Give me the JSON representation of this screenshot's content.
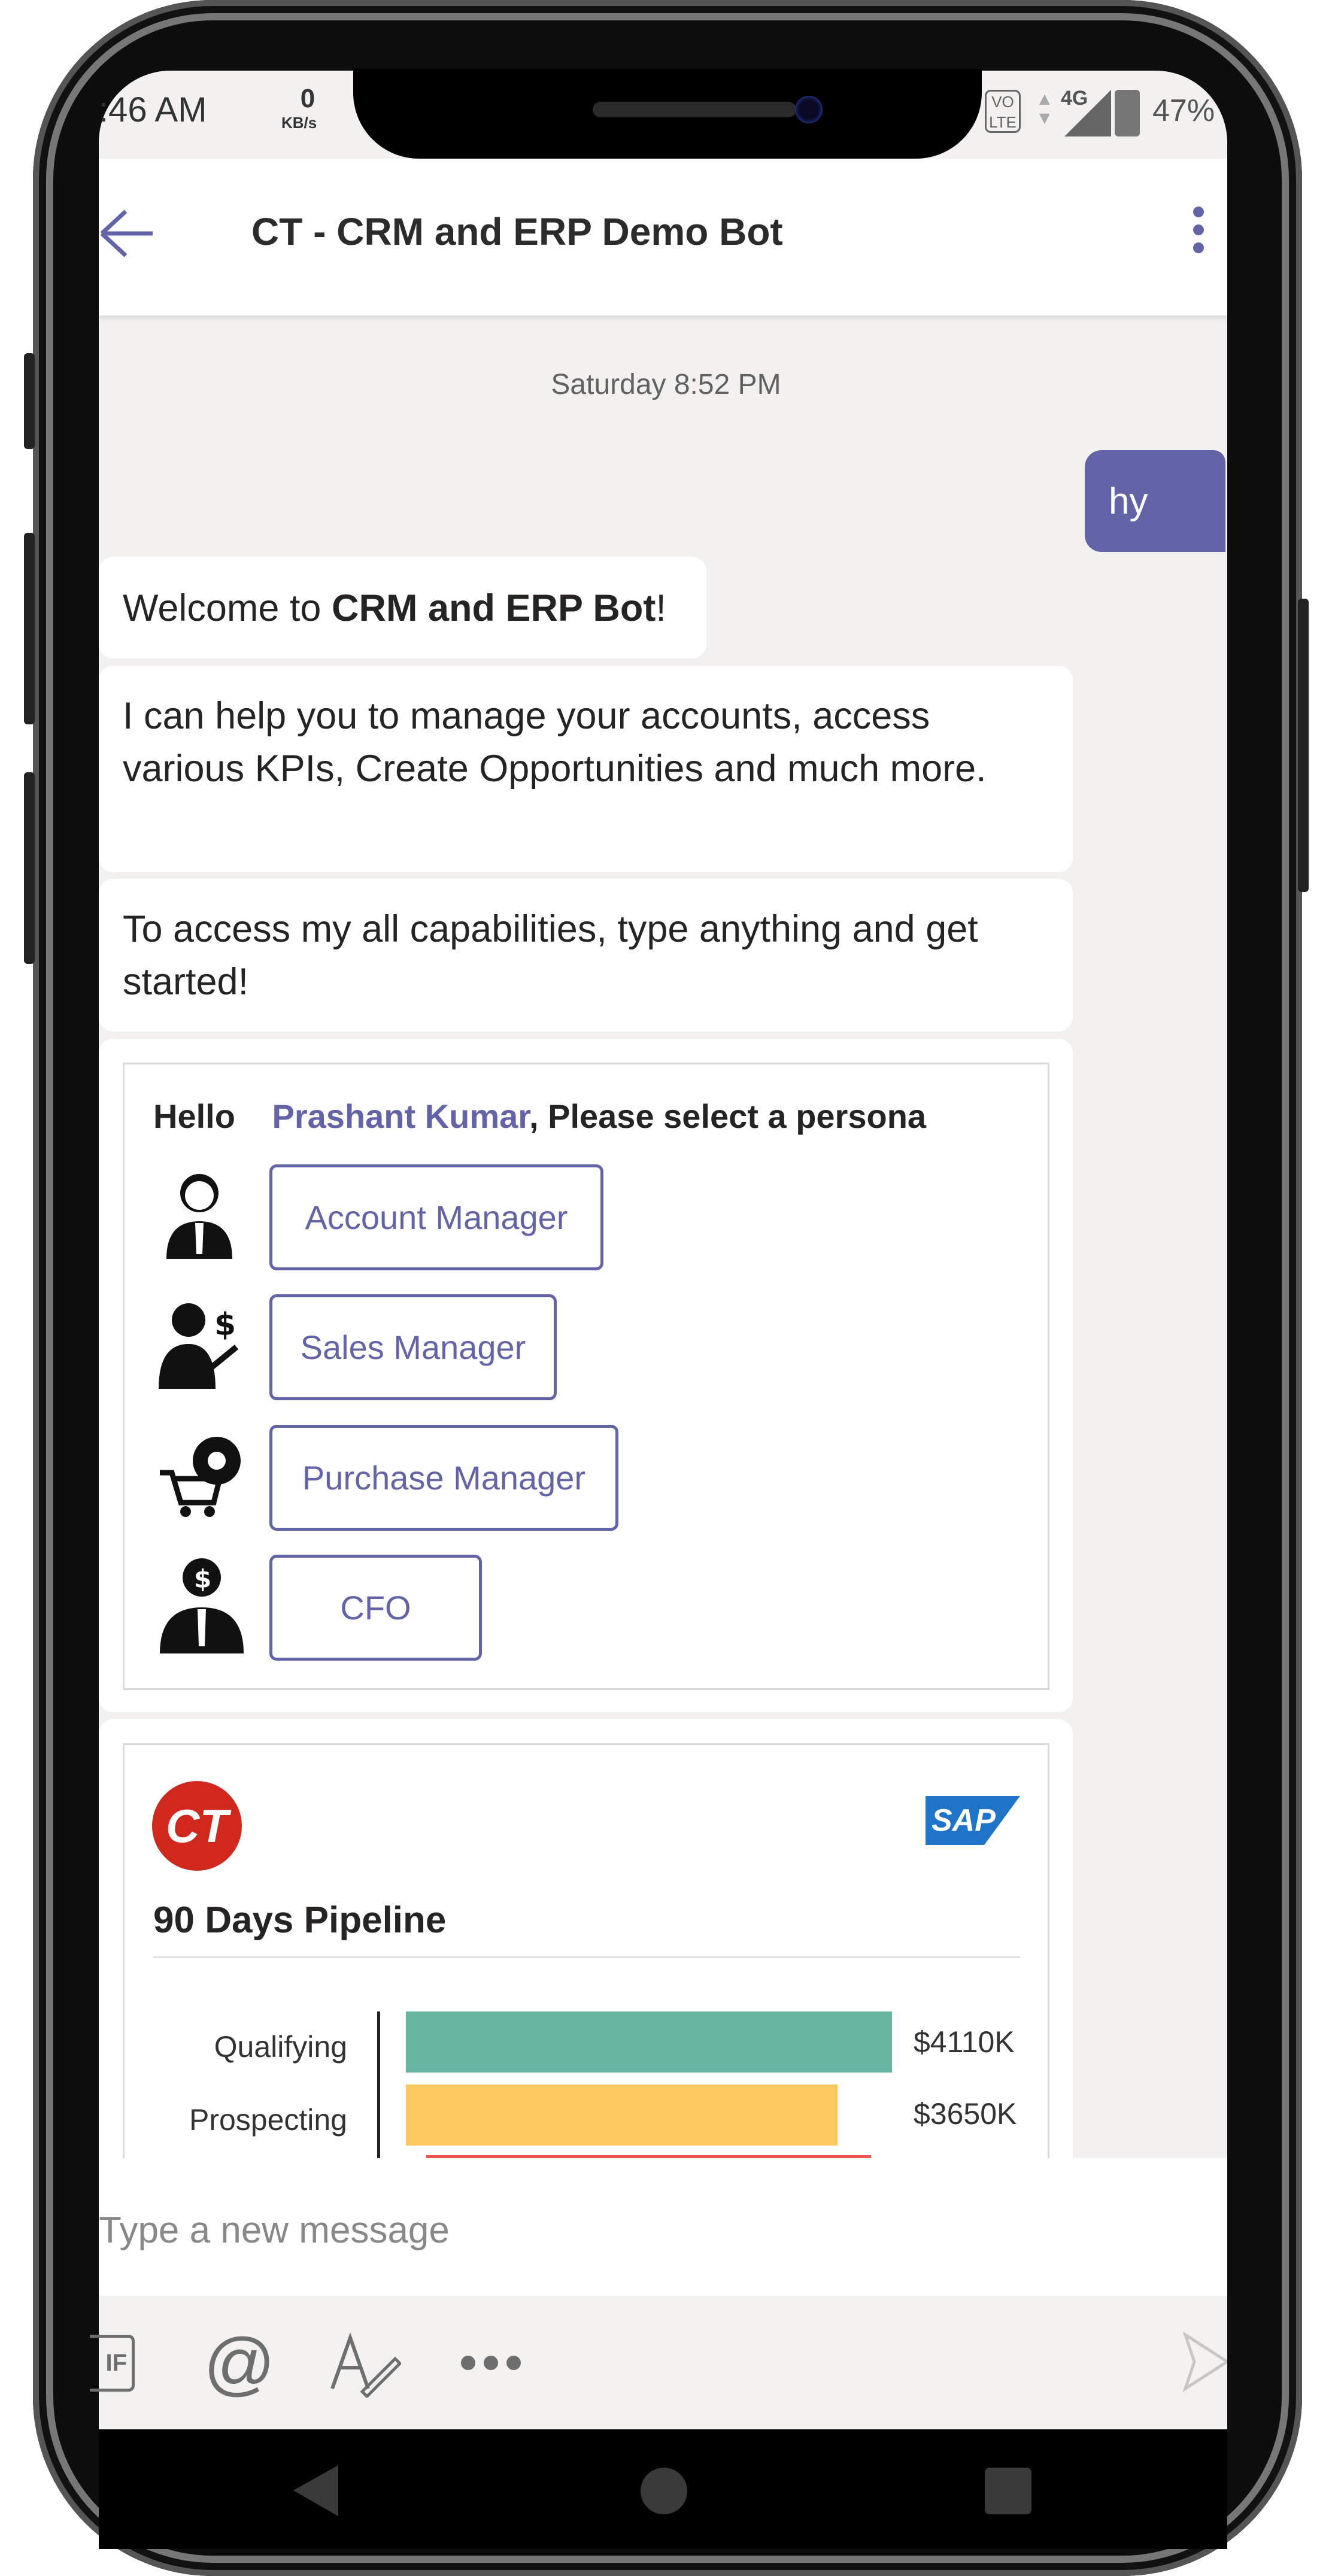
{
  "status_bar": {
    "time": ":46 AM",
    "net_speed_value": "0",
    "net_speed_unit": "KB/s",
    "network": "4G",
    "battery": "47%"
  },
  "header": {
    "title": "CT - CRM and ERP Demo Bot"
  },
  "conversation": {
    "timestamp": "Saturday 8:52 PM",
    "user_message": "hy",
    "welcome_prefix": "Welcome to ",
    "welcome_bold": "CRM and ERP Bot",
    "welcome_suffix": "!",
    "help_text": "I can help you to manage your accounts, access various KPIs, Create Opportunities and much more.",
    "start_text": "To access my all capabilities, type anything and get started!"
  },
  "persona_card": {
    "greeting": "Hello",
    "user_name": "Prashant Kumar",
    "prompt": ", Please select a persona",
    "options": [
      "Account Manager",
      "Sales Manager",
      "Purchase Manager",
      "CFO"
    ]
  },
  "pipeline_card": {
    "logo_text": "CT",
    "partner_logo": "SAP",
    "title": "90 Days Pipeline"
  },
  "chart_data": {
    "type": "bar",
    "orientation": "horizontal",
    "categories": [
      "Qualifying",
      "Prospecting"
    ],
    "values": [
      4110,
      3650
    ],
    "value_labels": [
      "$4110K",
      "$3650K"
    ],
    "colors": [
      "#66b5a0",
      "#fbc75f",
      "#ef5350"
    ]
  },
  "composer": {
    "placeholder": "Type a new message"
  },
  "toolbar": {
    "icons": [
      "gif-icon",
      "mention-icon",
      "format-icon",
      "more-icon",
      "send-icon"
    ]
  }
}
